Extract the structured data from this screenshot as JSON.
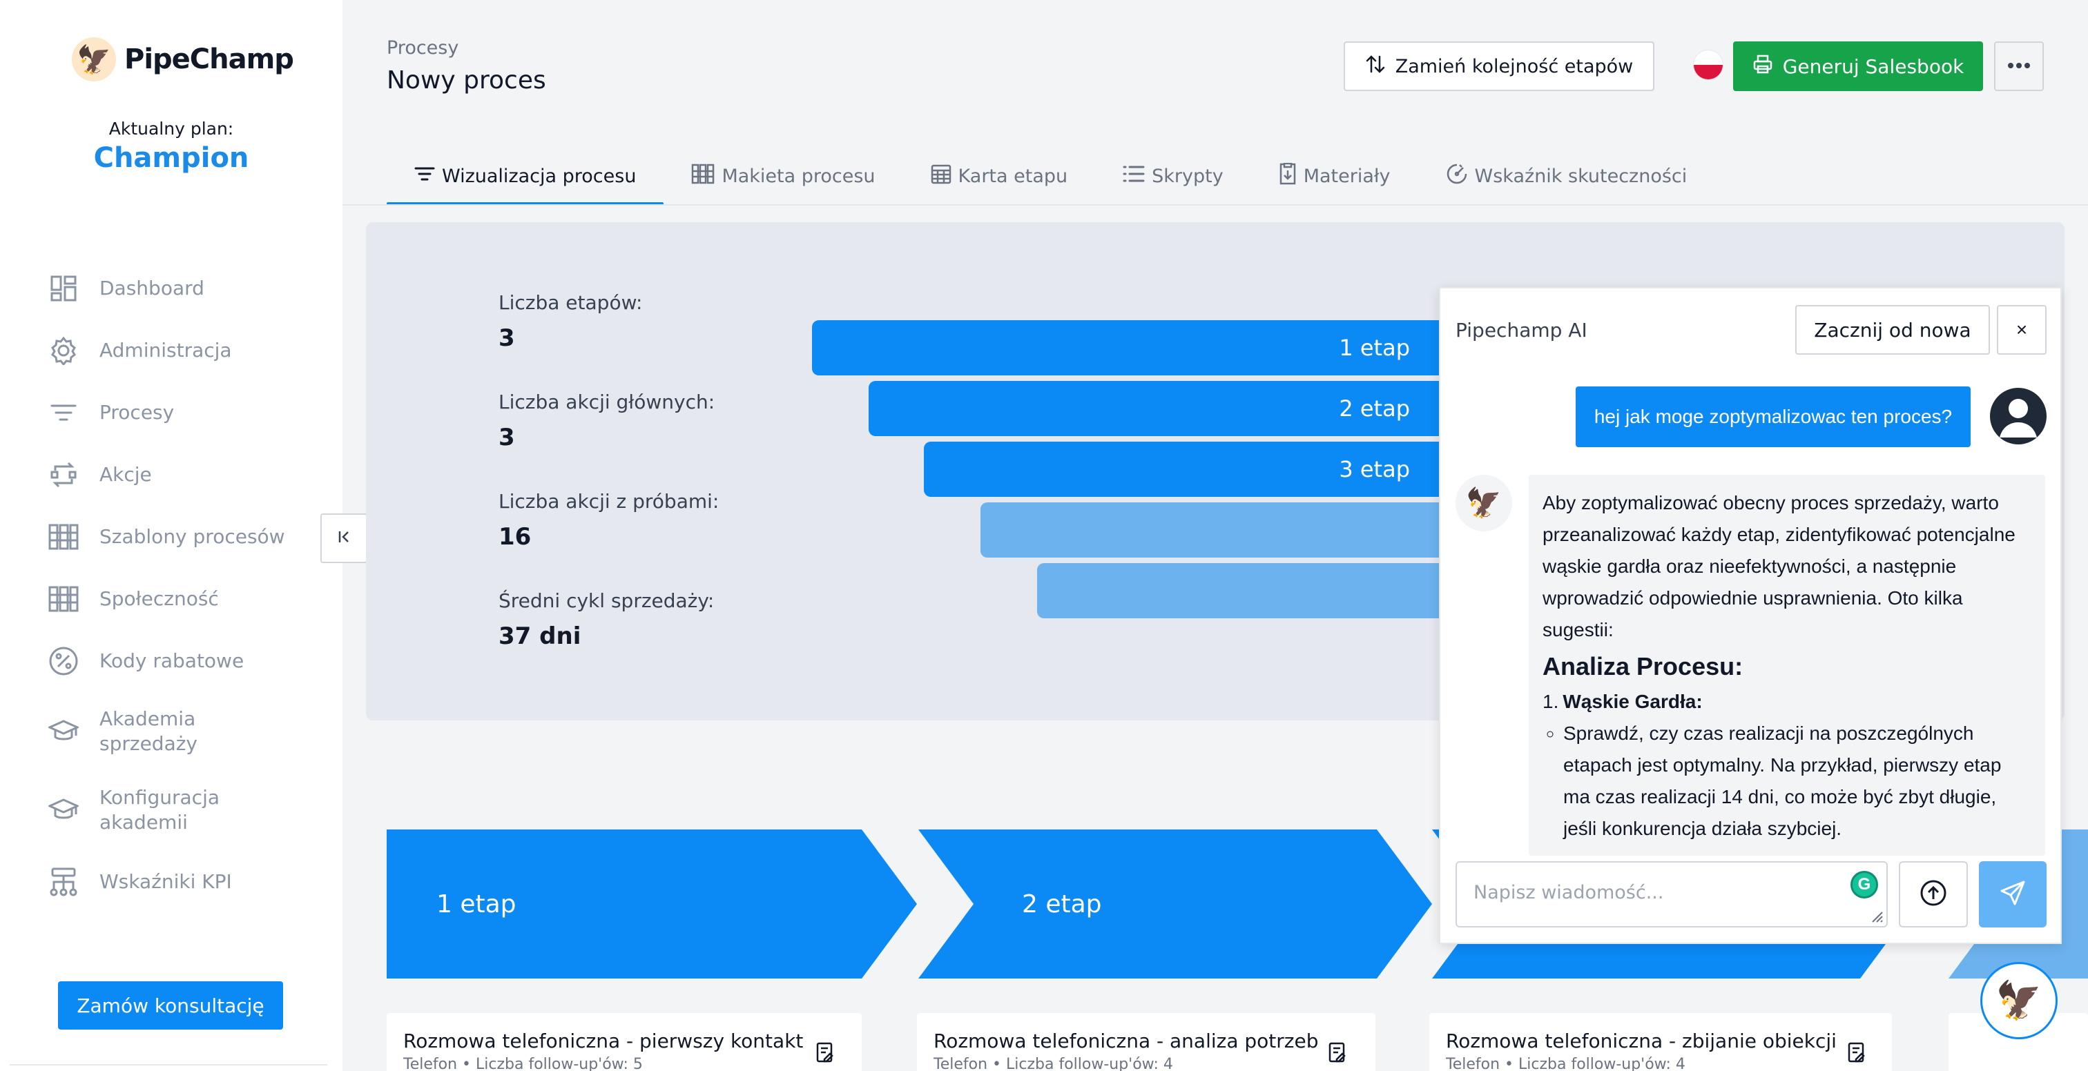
{
  "app": {
    "name": "PipeChamp",
    "brand_color": "#0b8af5"
  },
  "sidebar": {
    "plan_label": "Aktualny plan:",
    "plan_name": "Champion",
    "items": [
      {
        "label": "Dashboard",
        "icon": "dashboard-icon"
      },
      {
        "label": "Administracja",
        "icon": "gear-icon"
      },
      {
        "label": "Procesy",
        "icon": "filter-icon"
      },
      {
        "label": "Akcje",
        "icon": "actions-icon"
      },
      {
        "label": "Szablony procesów",
        "icon": "templates-icon"
      },
      {
        "label": "Społeczność",
        "icon": "community-icon"
      },
      {
        "label": "Kody rabatowe",
        "icon": "percent-icon"
      },
      {
        "label": "Akademia sprzedaży",
        "icon": "graduation-cap-icon"
      },
      {
        "label": "Konfiguracja akademii",
        "icon": "graduation-cap-icon"
      },
      {
        "label": "Wskaźniki KPI",
        "icon": "kpi-icon"
      }
    ],
    "consult_button": "Zamów konsultację"
  },
  "header": {
    "breadcrumb": "Procesy",
    "title": "Nowy proces",
    "swap_button": "Zamień kolejność etapów",
    "generate_button": "Generuj Salesbook",
    "generate_color": "#16a34a"
  },
  "tabs": [
    {
      "label": "Wizualizacja procesu",
      "active": true
    },
    {
      "label": "Makieta procesu",
      "active": false
    },
    {
      "label": "Karta etapu",
      "active": false
    },
    {
      "label": "Skrypty",
      "active": false
    },
    {
      "label": "Materiały",
      "active": false
    },
    {
      "label": "Wskaźnik skuteczności",
      "active": false
    }
  ],
  "stats": [
    {
      "label": "Liczba etapów:",
      "value": "3"
    },
    {
      "label": "Liczba akcji głównych:",
      "value": "3"
    },
    {
      "label": "Liczba akcji z próbami:",
      "value": "16"
    },
    {
      "label": "Średni cykl sprzedaży:",
      "value": "37 dni"
    }
  ],
  "funnel": [
    {
      "label": "1 etap",
      "color": "#0b8af5"
    },
    {
      "label": "2 etap",
      "color": "#0b8af5"
    },
    {
      "label": "3 etap",
      "color": "#0b8af5"
    },
    {
      "label": "",
      "color": "#6cb2ee"
    },
    {
      "label": "",
      "color": "#6cb2ee"
    }
  ],
  "stages": [
    {
      "label": "1 etap"
    },
    {
      "label": "2 etap"
    }
  ],
  "cards": [
    {
      "title": "Rozmowa telefoniczna - pierwszy kontakt",
      "subtitle": "Telefon • Liczba follow-up'ów: 5"
    },
    {
      "title": "Rozmowa telefoniczna - analiza potrzeb",
      "subtitle": "Telefon • Liczba follow-up'ów: 4"
    },
    {
      "title": "Rozmowa telefoniczna - zbijanie obiekcji",
      "subtitle": "Telefon • Liczba follow-up'ów: 4"
    }
  ],
  "chat": {
    "title": "Pipechamp AI",
    "restart_button": "Zacznij od nowa",
    "close_label": "×",
    "user_message": "hej jak moge zoptymalizowac ten proces?",
    "bot_intro": "Aby zoptymalizować obecny proces sprzedaży, warto przeanalizować każdy etap, zidentyfikować potencjalne wąskie gardła oraz nieefektywności, a następnie wprowadzić odpowiednie usprawnienia. Oto kilka sugestii:",
    "bot_heading": "Analiza Procesu:",
    "bot_item_num": "1.",
    "bot_item_title": "Wąskie Gardła:",
    "bot_subitem": "Sprawdź, czy czas realizacji na poszczególnych etapach jest optymalny. Na przykład, pierwszy etap ma czas realizacji 14 dni, co może być zbyt długie, jeśli konkurencja działa szybciej.",
    "input_placeholder": "Napisz wiadomość..."
  }
}
